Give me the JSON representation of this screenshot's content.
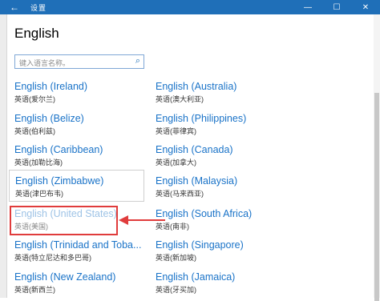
{
  "window": {
    "title": "设置",
    "back_glyph": "←",
    "minimize_glyph": "—",
    "maximize_glyph": "☐",
    "close_glyph": "✕"
  },
  "page": {
    "heading": "English"
  },
  "search": {
    "placeholder": "键入语言名称。"
  },
  "languages": [
    {
      "name": "English (Ireland)",
      "native": "英语(爱尔兰)"
    },
    {
      "name": "English (Australia)",
      "native": "英语(澳大利亚)"
    },
    {
      "name": "English (Belize)",
      "native": "英语(伯利兹)"
    },
    {
      "name": "English (Philippines)",
      "native": "英语(菲律宾)"
    },
    {
      "name": "English (Caribbean)",
      "native": "英语(加勒比海)"
    },
    {
      "name": "English (Canada)",
      "native": "英语(加拿大)"
    },
    {
      "name": "English (Zimbabwe)",
      "native": "英语(津巴布韦)"
    },
    {
      "name": "English (Malaysia)",
      "native": "英语(马来西亚)"
    },
    {
      "name": "English (United States)",
      "native": "英语(美国)"
    },
    {
      "name": "English (South Africa)",
      "native": "英语(南非)"
    },
    {
      "name": "English (Trinidad and Toba...",
      "native": "英语(特立尼达和多巴哥)"
    },
    {
      "name": "English (Singapore)",
      "native": "英语(新加坡)"
    },
    {
      "name": "English (New Zealand)",
      "native": "英语(新西兰)"
    },
    {
      "name": "English (Jamaica)",
      "native": "英语(牙买加)"
    }
  ],
  "colors": {
    "titlebar": "#1f6fb8",
    "link": "#1a73c8",
    "highlight_box": "#e03c3c"
  }
}
